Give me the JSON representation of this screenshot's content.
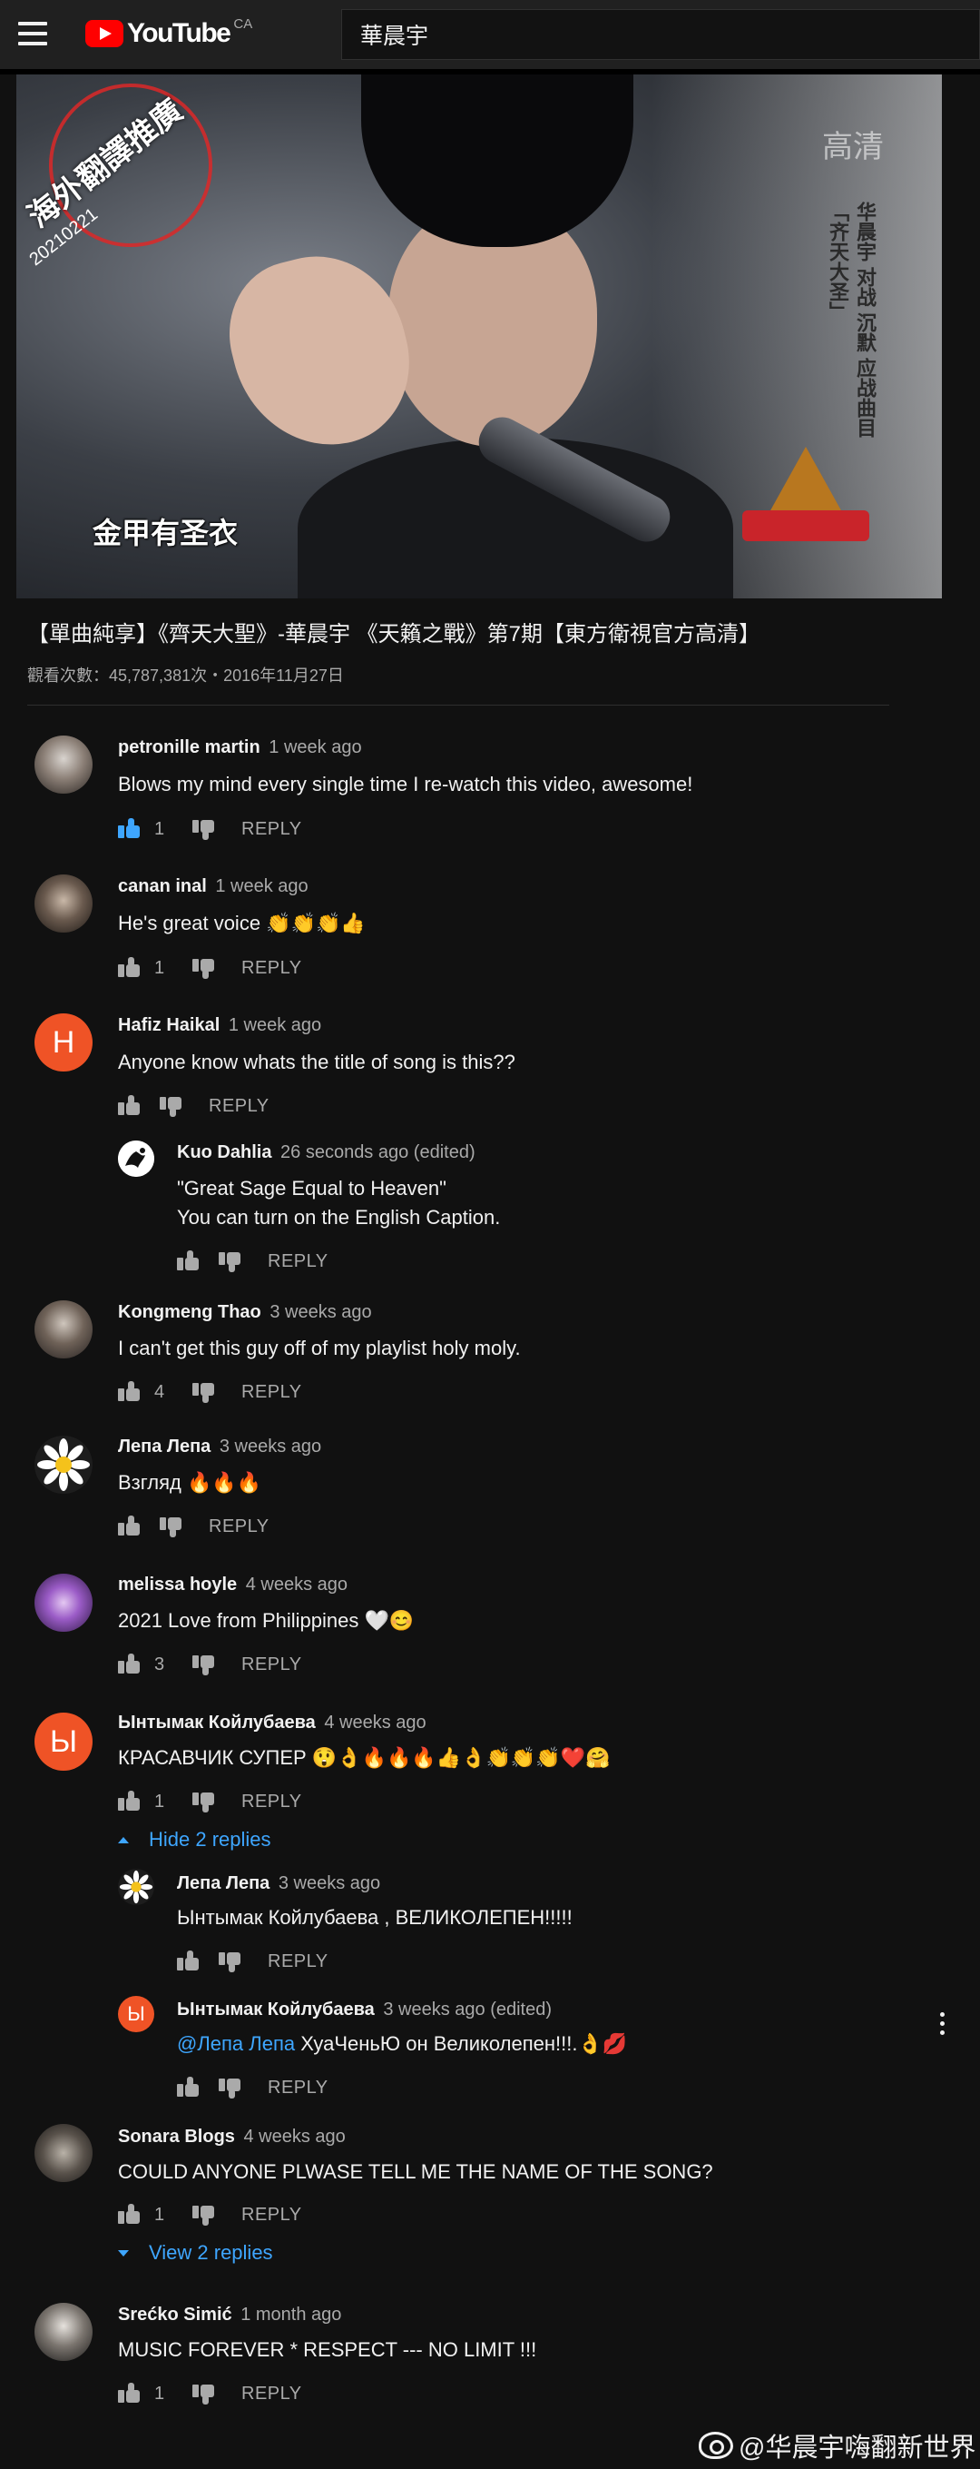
{
  "topbar": {
    "logo_text": "YouTube",
    "region": "CA",
    "search_value": "華晨宇"
  },
  "video": {
    "overlay_stamp": "海外翻譯推廣",
    "overlay_date": "20210221",
    "hd_tag": "高清",
    "side_caption_line1": "华晨宇 对战 沉默",
    "side_caption_line2": "应战曲目「齐天大圣」",
    "subtitle": "金甲有圣衣",
    "title": "【單曲純享】《齊天大聖》-華晨宇 《天籟之戰》第7期【東方衛視官方高清】",
    "views": "觀看次數：45,787,381次・2016年11月27日"
  },
  "reply_label": "REPLY",
  "comments": [
    {
      "author": "petronille martin",
      "time": "1 week ago",
      "text": "Blows my mind every single time I re-watch this video, awesome!",
      "likes": "1"
    },
    {
      "author": "canan inal",
      "time": "1 week ago",
      "text": "He's great voice 👏👏👏👍",
      "likes": "1"
    },
    {
      "author": "Hafiz Haikal",
      "time": "1 week ago",
      "text": "Anyone know whats the title of song is this??",
      "likes": "",
      "avatar_letter": "H"
    },
    {
      "author": "Kuo Dahlia",
      "time": "26 seconds ago (edited)",
      "text": "\"Great Sage Equal to Heaven\"",
      "text2": "You can turn on the English Caption.",
      "likes": ""
    },
    {
      "author": "Kongmeng Thao",
      "time": "3 weeks ago",
      "text": "I can't get this guy off of my playlist holy moly.",
      "likes": "4"
    },
    {
      "author": "Лепа Лепа",
      "time": "3 weeks ago",
      "text": "Взгляд 🔥🔥🔥",
      "likes": ""
    },
    {
      "author": "melissa hoyle",
      "time": "4 weeks ago",
      "text": "2021 Love from Philippines 🤍😊",
      "likes": "3"
    },
    {
      "author": "Ынтымак Койлубаева",
      "time": "4 weeks ago",
      "text": "КРАСАВЧИК СУПЕР 😲👌🔥🔥🔥👍👌👏👏👏❤️🤗",
      "likes": "1",
      "avatar_letter": "Ы"
    },
    {
      "author": "Лепа Лепа",
      "time": "3 weeks ago",
      "text": "Ынтымак Койлубаева , ВЕЛИКОЛЕПЕН!!!!!",
      "likes": ""
    },
    {
      "author": "Ынтымак Койлубаева",
      "time": "3 weeks ago (edited)",
      "mention": "@Лепа Лепа",
      "text": " ХуаЧеньЮ он Великолепен!!!.👌💋",
      "likes": "",
      "avatar_letter": "Ы"
    },
    {
      "author": "Sonara Blogs",
      "time": "4 weeks ago",
      "text": "COULD ANYONE PLWASE TELL ME THE NAME OF THE SONG?",
      "likes": "1"
    },
    {
      "author": "Srećko Simić",
      "time": "1 month ago",
      "text": "MUSIC FOREVER * RESPECT --- NO LIMIT !!!",
      "likes": "1"
    }
  ],
  "hide_replies_label": "Hide 2 replies",
  "view_replies_label": "View 2 replies",
  "watermark": "@华晨宇嗨翻新世界",
  "colors": {
    "background": "#111111",
    "topbar": "#202020",
    "accent_link": "#3ea6ff",
    "avatar_orange": "#ef5326",
    "brand_red": "#ff0000"
  }
}
